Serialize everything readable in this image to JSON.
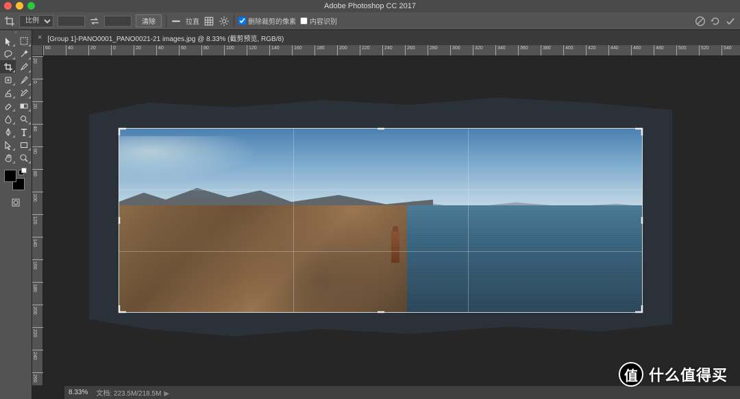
{
  "app_title": "Adobe Photoshop CC 2017",
  "doc_tab": "[Group 1]-PANO0001_PANO0021-21 images.jpg @ 8.33% (截剪预览, RGB/8)",
  "options": {
    "ratio_label": "比例",
    "swap_icon": "swap-icon",
    "clear_label": "清除",
    "straighten_label": "拉直",
    "grid_icon": "grid-icon",
    "gear_icon": "gear-icon",
    "checkbox_delete_label": "删除裁剪的像素",
    "checkbox_content_aware_label": "内容识别",
    "checkbox_delete_checked": true,
    "checkbox_content_aware_checked": false
  },
  "ruler_h_ticks": [
    "60",
    "40",
    "20",
    "0",
    "20",
    "40",
    "60",
    "80",
    "100",
    "120",
    "140",
    "160",
    "180",
    "200",
    "220",
    "240",
    "260",
    "280",
    "300",
    "320",
    "340",
    "360",
    "380",
    "400",
    "420",
    "440",
    "460",
    "480",
    "500",
    "520",
    "540"
  ],
  "ruler_v_ticks": [
    "20",
    "0",
    "20",
    "40",
    "60",
    "80",
    "100",
    "120",
    "140",
    "160",
    "180",
    "200",
    "220",
    "240",
    "260"
  ],
  "tools": [
    {
      "n": "move-tool"
    },
    {
      "n": "marquee-tool"
    },
    {
      "n": "lasso-tool"
    },
    {
      "n": "magic-wand-tool"
    },
    {
      "n": "crop-tool",
      "active": true
    },
    {
      "n": "eyedropper-tool"
    },
    {
      "n": "healing-brush-tool"
    },
    {
      "n": "brush-tool"
    },
    {
      "n": "clone-stamp-tool"
    },
    {
      "n": "history-brush-tool"
    },
    {
      "n": "eraser-tool"
    },
    {
      "n": "gradient-tool"
    },
    {
      "n": "blur-tool"
    },
    {
      "n": "dodge-tool"
    },
    {
      "n": "pen-tool"
    },
    {
      "n": "type-tool"
    },
    {
      "n": "path-select-tool"
    },
    {
      "n": "rectangle-tool"
    },
    {
      "n": "hand-tool"
    },
    {
      "n": "zoom-tool"
    }
  ],
  "status": {
    "zoom": "8.33%",
    "doc_info": "文档: 223.5M/218.5M"
  },
  "commit_bar": {
    "cancel_icon": "cancel-icon",
    "reset_icon": "reset-icon",
    "commit_icon": "check-icon"
  },
  "watermark": {
    "badge": "值",
    "text": "什么值得买"
  }
}
